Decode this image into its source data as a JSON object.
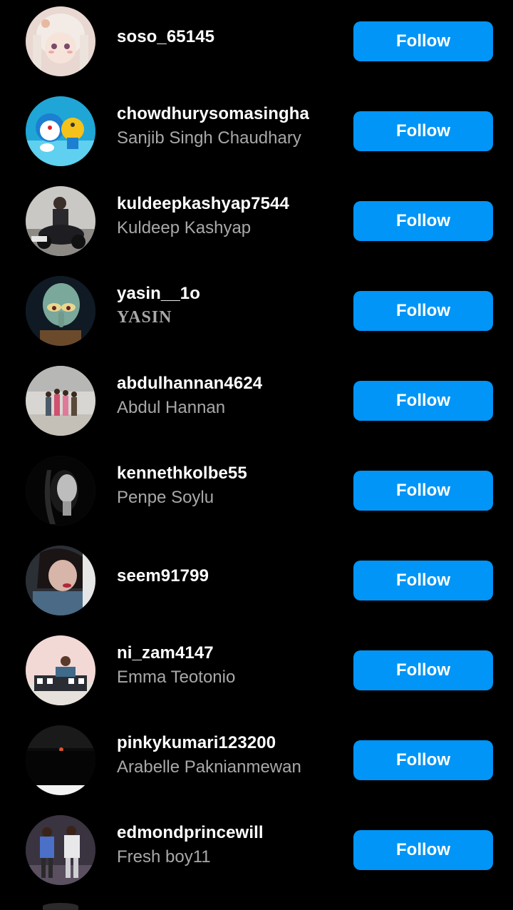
{
  "colors": {
    "background": "#000000",
    "button": "#0095f6",
    "username": "#ffffff",
    "fullname": "#a8a8a8"
  },
  "follow_label": "Follow",
  "accounts": [
    {
      "username": "soso_65145",
      "fullname": "",
      "avatar": "anime-girl-avatar"
    },
    {
      "username": "chowdhurysomasingha",
      "fullname": "Sanjib Singh Chaudhary",
      "avatar": "doraemon-avatar"
    },
    {
      "username": "kuldeepkashyap7544",
      "fullname": "Kuldeep Kashyap",
      "avatar": "motorbike-man-avatar"
    },
    {
      "username": "yasin__1o",
      "fullname": "YASIN",
      "avatar": "squidward-avatar"
    },
    {
      "username": "abdulhannan4624",
      "fullname": "Abdul Hannan",
      "avatar": "children-group-avatar"
    },
    {
      "username": "kennethkolbe55",
      "fullname": "Penpe Soylu",
      "avatar": "woman-portrait-avatar"
    },
    {
      "username": "seem91799",
      "fullname": "",
      "avatar": "woman-scarf-avatar"
    },
    {
      "username": "ni_zam4147",
      "fullname": "Emma Teotonio",
      "avatar": "man-on-sofa-avatar"
    },
    {
      "username": "pinkykumari123200",
      "fullname": "Arabelle Paknianmewan",
      "avatar": "sunset-avatar"
    },
    {
      "username": "edmondprincewill",
      "fullname": "Fresh boy11",
      "avatar": "two-men-sunday-avatar"
    }
  ]
}
